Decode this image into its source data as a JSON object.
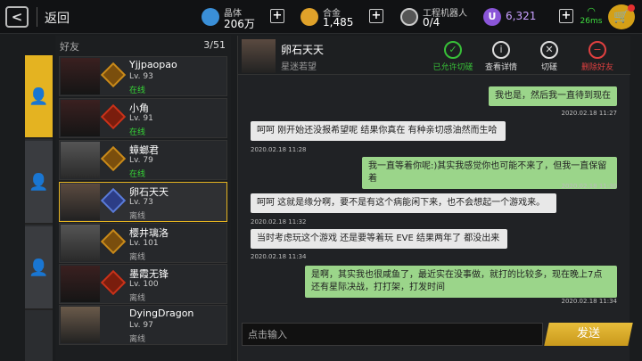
{
  "topbar": {
    "back_label": "返回",
    "resources": [
      {
        "label": "晶体",
        "value": "206万",
        "icon": "crystal-icon",
        "color": "#3a8fd8"
      },
      {
        "label": "合金",
        "value": "1,485",
        "icon": "alloy-icon",
        "color": "#e0a22a"
      },
      {
        "label": "工程机器人",
        "value": "0/4",
        "icon": "robot-icon",
        "color": "#cccccc"
      },
      {
        "label": "",
        "value": "6,321",
        "icon": "u-currency-icon",
        "color": "#8a55d8"
      }
    ],
    "ping": "26ms"
  },
  "friends": {
    "title": "好友",
    "count": "3/51",
    "items": [
      {
        "name": "Yjjpaopao",
        "level": "Lv. 93",
        "status": "在线",
        "online": true
      },
      {
        "name": "小角",
        "level": "Lv. 91",
        "status": "在线",
        "online": true
      },
      {
        "name": "蟑螂君",
        "level": "Lv. 79",
        "status": "在线",
        "online": true
      },
      {
        "name": "卵石天天",
        "level": "Lv. 73",
        "status": "离线",
        "online": false
      },
      {
        "name": "樱井璃洛",
        "level": "Lv. 101",
        "status": "离线",
        "online": false
      },
      {
        "name": "墨霞无锋",
        "level": "Lv. 100",
        "status": "离线",
        "online": false
      },
      {
        "name": "DyingDragon",
        "level": "Lv. 97",
        "status": "离线",
        "online": false
      }
    ]
  },
  "chat": {
    "name": "卵石天天",
    "subtitle": "星迷若望",
    "actions": [
      {
        "label": "已允许切磋",
        "icon": "check-circle-icon"
      },
      {
        "label": "查看详情",
        "icon": "info-icon"
      },
      {
        "label": "切磋",
        "icon": "duel-icon"
      },
      {
        "label": "删除好友",
        "icon": "remove-friend-icon"
      }
    ],
    "messages": [
      {
        "text": "我也是，然后我一直待到现在",
        "time": "2020.02.18 11:27",
        "me": true
      },
      {
        "text": "呵呵 刚开始还没报希望呢 结果你真在 有种亲切感油然而生哈",
        "time": "2020.02.18 11:28",
        "me": false
      },
      {
        "text": "我一直等着你呢:)其实我感觉你也可能不来了，但我一直保留着",
        "time": "2020.02.18 11:30",
        "me": true
      },
      {
        "text": "呵呵 这就是缘分啊，要不是有这个病能闲下来，也不会想起一个游戏来。",
        "time": "2020.02.18 11:32",
        "me": false
      },
      {
        "text": "当时考虑玩这个游戏 还是要等着玩 EVE 结果两年了 都没出来",
        "time": "2020.02.18 11:34",
        "me": false
      },
      {
        "text": "是啊，其实我也很咸鱼了，最近实在没事做，就打的比较多，现在晚上7点还有星际决战，打打架，打发时间",
        "time": "2020.02.18 11:34",
        "me": true
      }
    ],
    "input_placeholder": "点击输入",
    "send_label": "发送"
  }
}
